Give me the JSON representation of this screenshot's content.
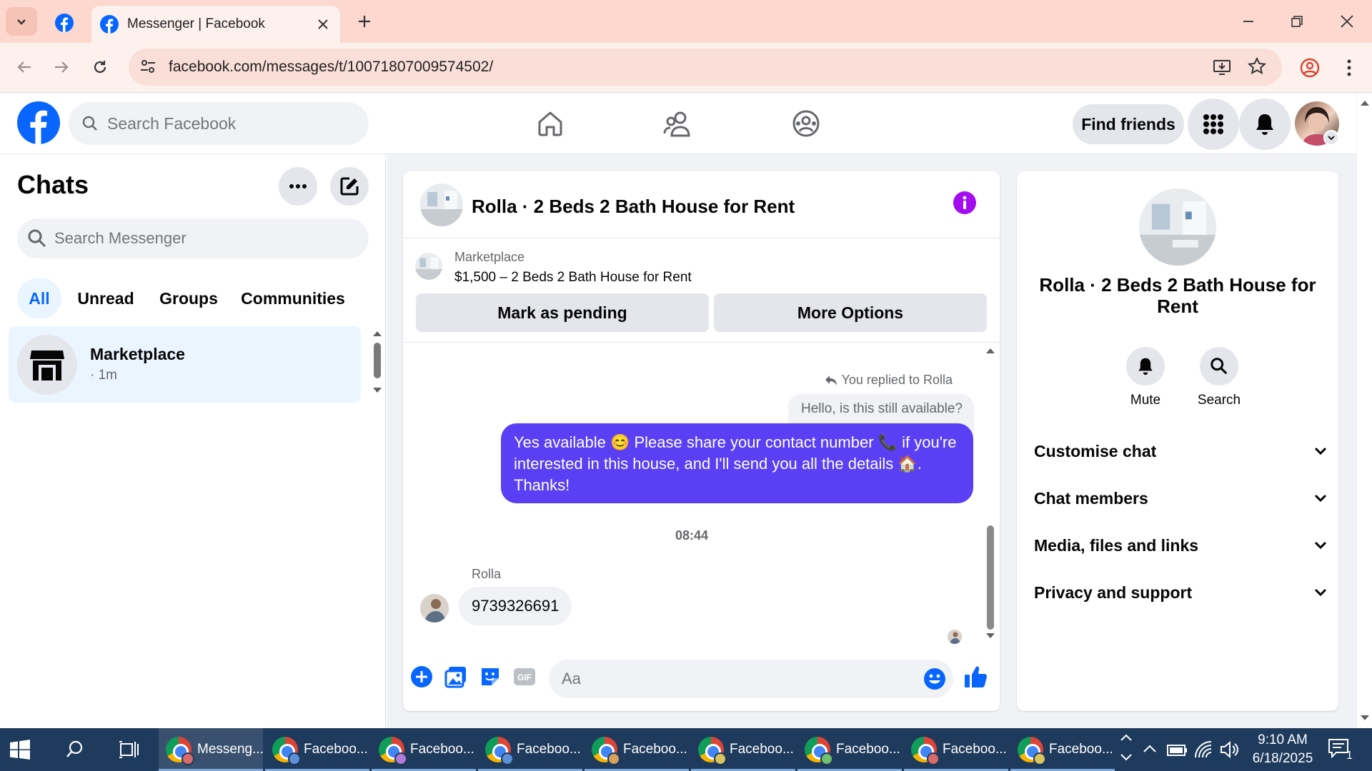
{
  "browser": {
    "tab_title": "Messenger | Facebook",
    "url": "facebook.com/messages/t/10071807009574502/"
  },
  "header": {
    "search_placeholder": "Search Facebook",
    "find_friends": "Find friends"
  },
  "sidebar": {
    "title": "Chats",
    "search_placeholder": "Search Messenger",
    "filters": [
      "All",
      "Unread",
      "Groups",
      "Communities"
    ],
    "active_filter": "All",
    "conversations": [
      {
        "name": "Marketplace",
        "meta": "· 1m"
      }
    ]
  },
  "chat": {
    "title": "Rolla · 2 Beds 2 Bath House for Rent",
    "listing": {
      "source": "Marketplace",
      "summary": "$1,500 – 2 Beds 2 Bath House for Rent"
    },
    "mark_pending": "Mark as pending",
    "more_options": "More Options",
    "reply_note": "You replied to Rolla",
    "quoted_message": "Hello, is this still available?",
    "sent_message": "Yes available 😊 Please share your contact number 📞 if you're interested in this house, and I'll send you all the details 🏠. Thanks!",
    "timestamp": "08:44",
    "sender_name": "Rolla",
    "received_message": "9739326691",
    "composer_placeholder": "Aa"
  },
  "info_panel": {
    "title": "Rolla · 2 Beds 2 Bath House for Rent",
    "mute_label": "Mute",
    "search_label": "Search",
    "sections": [
      "Customise chat",
      "Chat members",
      "Media, files and links",
      "Privacy and support"
    ]
  },
  "taskbar": {
    "apps": [
      {
        "label": "Messeng...",
        "badge": "#d96a6a"
      },
      {
        "label": "Faceboo...",
        "badge": "#5d8fd6"
      },
      {
        "label": "Faceboo...",
        "badge": "#b07ad6"
      },
      {
        "label": "Faceboo...",
        "badge": "#5d8fd6"
      },
      {
        "label": "Faceboo...",
        "badge": "#d9a05d"
      },
      {
        "label": "Faceboo...",
        "badge": "#d9c35d"
      },
      {
        "label": "Faceboo...",
        "badge": "#6fc06f"
      },
      {
        "label": "Faceboo...",
        "badge": "#d96a6a"
      },
      {
        "label": "Faceboo...",
        "badge": "#d9c35d"
      }
    ],
    "time": "9:10 AM",
    "date": "6/18/2025",
    "notification_count": "1"
  },
  "colors": {
    "fb_blue": "#0866ff",
    "sent_bubble": "#5b3ff5",
    "info_purple": "#a30cf0",
    "selected_chat_bg": "#ebf5ff"
  }
}
